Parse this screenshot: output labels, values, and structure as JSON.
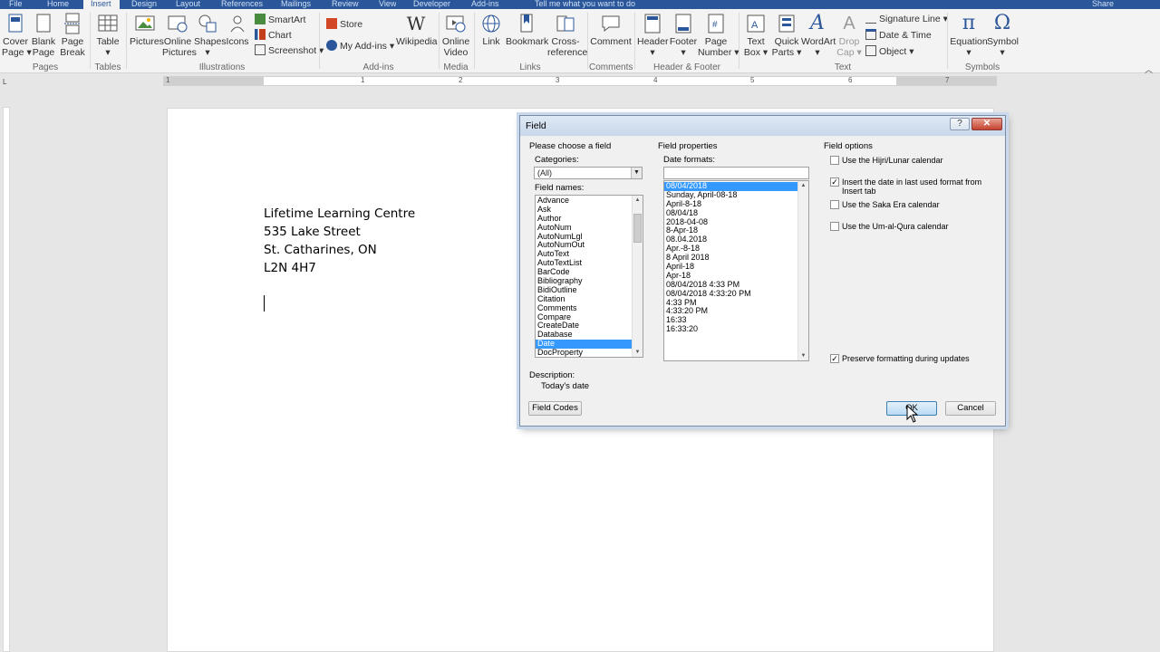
{
  "ribbon_tabs": [
    "File",
    "Home",
    "Insert",
    "Design",
    "Layout",
    "References",
    "Mailings",
    "Review",
    "View",
    "Developer",
    "Add-ins",
    "Tell me what you want to do",
    "Share"
  ],
  "ribbon": {
    "pages": {
      "group": "Pages",
      "cover": "Cover\nPage ▾",
      "blank": "Blank\nPage",
      "break": "Page\nBreak"
    },
    "tables": {
      "group": "Tables",
      "table": "Table\n▾"
    },
    "illustrations": {
      "group": "Illustrations",
      "pictures": "Pictures",
      "online": "Online\nPictures",
      "shapes": "Shapes\n▾",
      "icons": "Icons",
      "smartart": "SmartArt",
      "chart": "Chart",
      "screenshot": "Screenshot ▾"
    },
    "addins": {
      "group": "Add-ins",
      "store": "Store",
      "myaddins": "My Add-ins",
      "wikipedia": "Wikipedia"
    },
    "media": {
      "group": "Media",
      "video": "Online\nVideo"
    },
    "links": {
      "group": "Links",
      "link": "Link",
      "bookmark": "Bookmark",
      "xref": "Cross-\nreference"
    },
    "comments": {
      "group": "Comments",
      "comment": "Comment"
    },
    "hf": {
      "group": "Header & Footer",
      "header": "Header\n▾",
      "footer": "Footer\n▾",
      "pagenum": "Page\nNumber ▾"
    },
    "text": {
      "group": "Text",
      "textbox": "Text\nBox ▾",
      "quickparts": "Quick\nParts ▾",
      "wordart": "WordArt\n▾",
      "dropcap": "Drop\nCap ▾",
      "sigline": "Signature Line",
      "datetime": "Date & Time",
      "object": "Object"
    },
    "symbols": {
      "group": "Symbols",
      "equation": "Equation\n▾",
      "symbol": "Symbol\n▾"
    }
  },
  "ruler_numbers": [
    "1",
    "1",
    "2",
    "3",
    "4",
    "5",
    "6",
    "7"
  ],
  "document": {
    "lines": [
      "Lifetime Learning Centre",
      "535 Lake Street",
      "St. Catharines, ON",
      "L2N 4H7"
    ]
  },
  "dialog": {
    "title": "Field",
    "help": "?",
    "close": "✕",
    "choose_label": "Please choose a field",
    "categories_label": "Categories:",
    "categories_value": "(All)",
    "field_names_label": "Field names:",
    "field_names": [
      "Advance",
      "Ask",
      "Author",
      "AutoNum",
      "AutoNumLgl",
      "AutoNumOut",
      "AutoText",
      "AutoTextList",
      "BarCode",
      "Bibliography",
      "BidiOutline",
      "Citation",
      "Comments",
      "Compare",
      "CreateDate",
      "Database",
      "Date",
      "DocProperty"
    ],
    "field_selected": "Date",
    "props_label": "Field properties",
    "date_formats_label": "Date formats:",
    "date_formats": [
      "08/04/2018",
      "Sunday, April-08-18",
      "April-8-18",
      "08/04/18",
      "2018-04-08",
      "8-Apr-18",
      "08.04.2018",
      "Apr.-8-18",
      "8 April 2018",
      "April-18",
      "Apr-18",
      "08/04/2018 4:33 PM",
      "08/04/2018 4:33:20 PM",
      "4:33 PM",
      "4:33:20 PM",
      "16:33",
      "16:33:20"
    ],
    "date_selected": "08/04/2018",
    "options_label": "Field options",
    "options": [
      {
        "label": "Use the Hijri/Lunar calendar",
        "checked": false
      },
      {
        "label": "Insert the date in last used format from Insert tab",
        "checked": true
      },
      {
        "label": "Use the Saka Era calendar",
        "checked": false
      },
      {
        "label": "Use the Um-al-Qura calendar",
        "checked": false
      }
    ],
    "preserve_label": "Preserve formatting during updates",
    "preserve_checked": true,
    "description_label": "Description:",
    "description": "Today's date",
    "field_codes": "Field Codes",
    "ok": "OK",
    "cancel": "Cancel"
  },
  "colors": {
    "accent": "#2b579a",
    "selection": "#3399ff"
  }
}
